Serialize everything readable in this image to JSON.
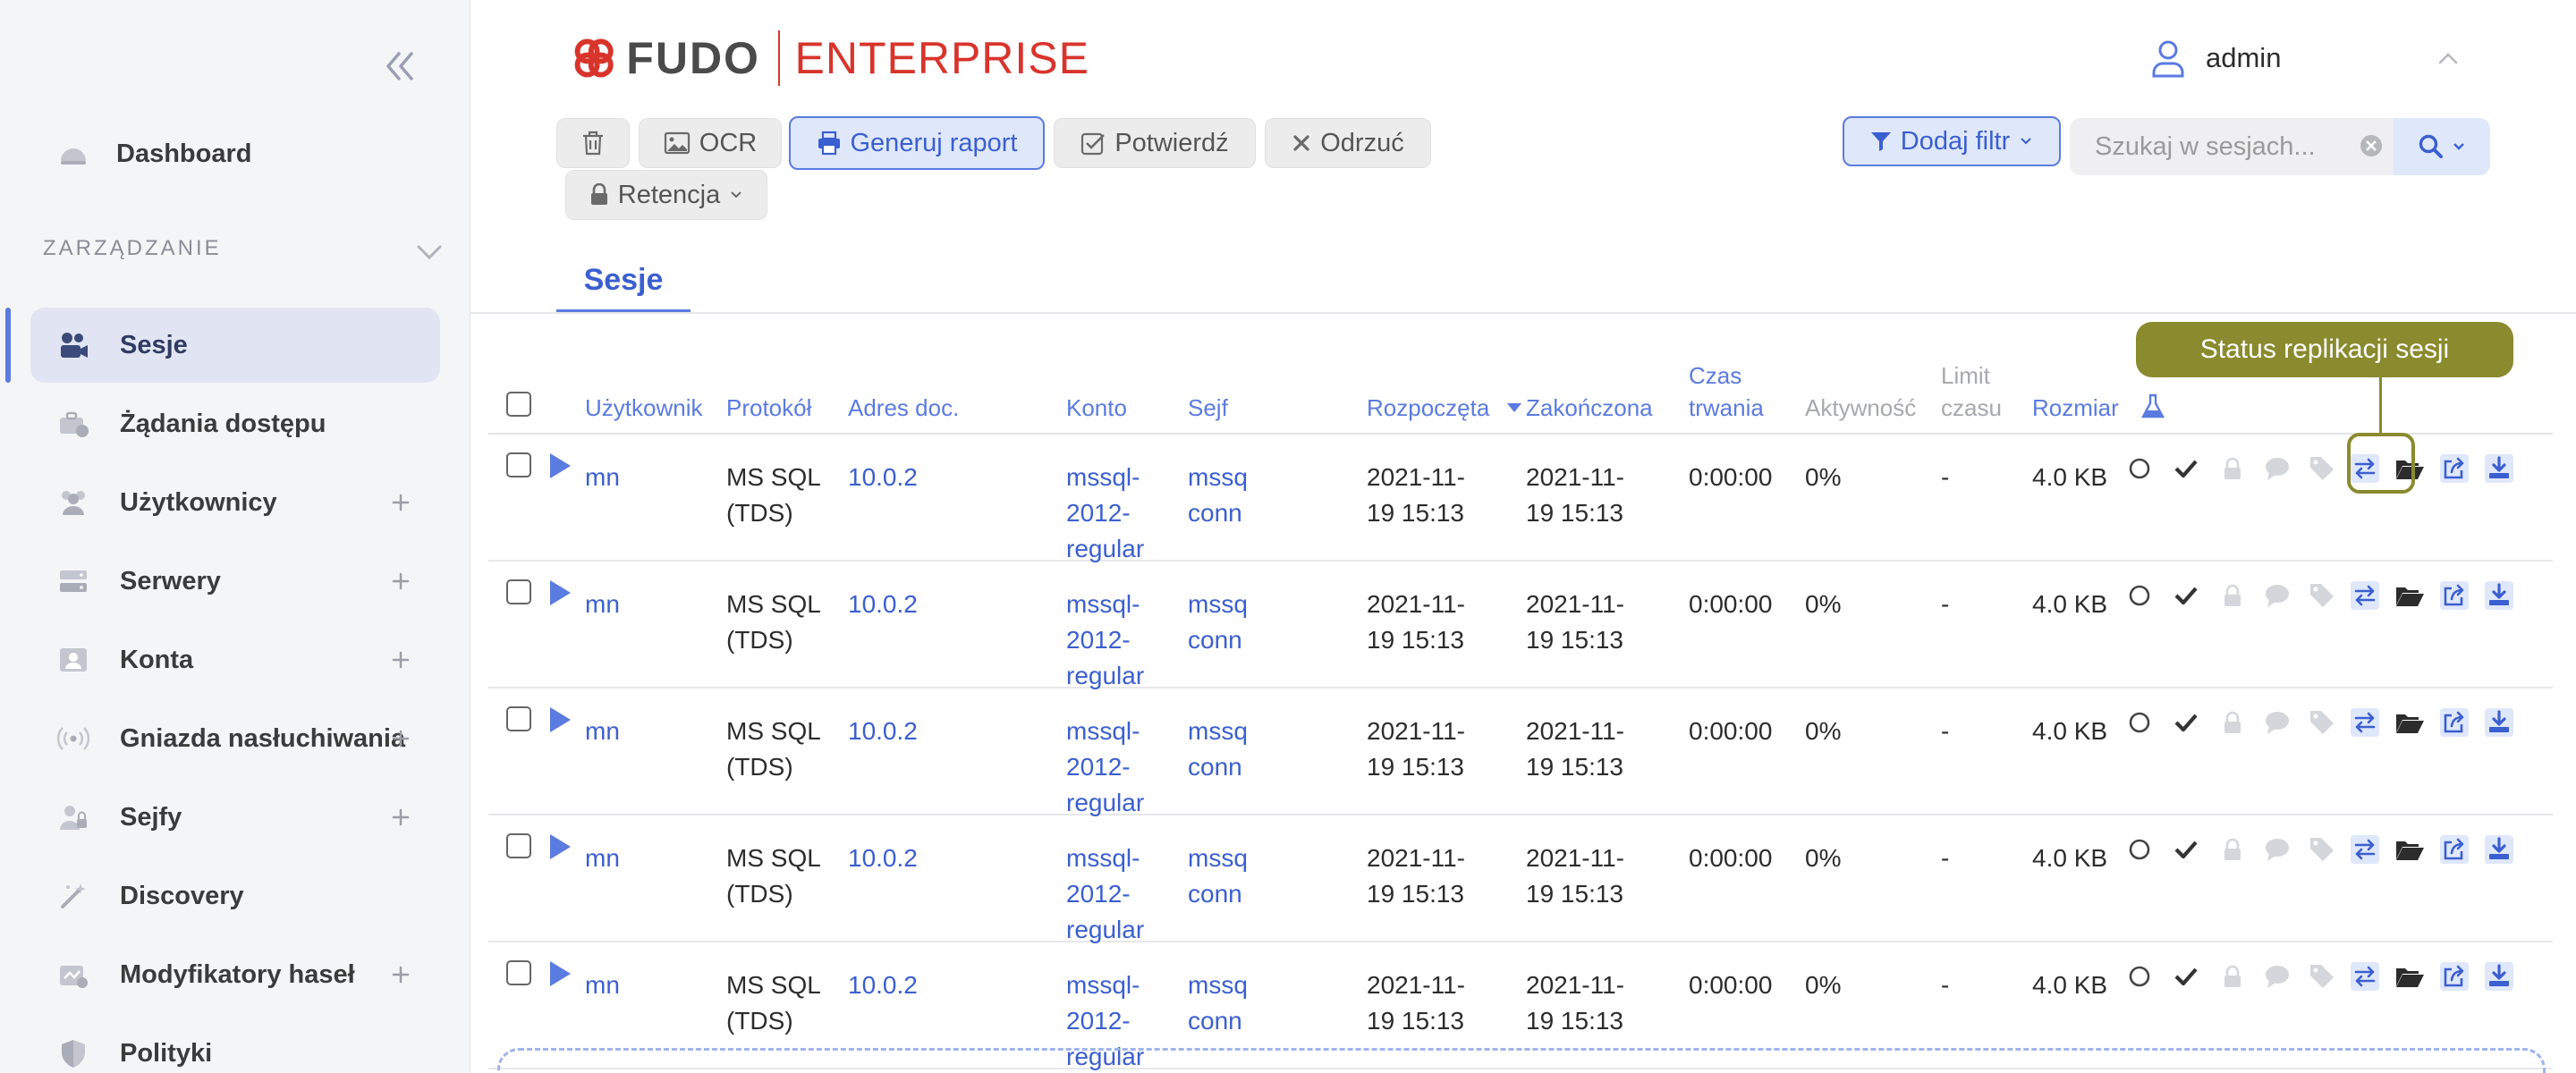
{
  "sidebar": {
    "section_label": "ZARZĄDZANIE",
    "items": [
      {
        "label": "Dashboard",
        "icon": "dashboard-icon",
        "expandable": false,
        "active": false
      },
      {
        "label": "Sesje",
        "icon": "sessions-icon",
        "expandable": false,
        "active": true
      },
      {
        "label": "Żądania dostępu",
        "icon": "briefcase-icon",
        "expandable": false,
        "active": false
      },
      {
        "label": "Użytkownicy",
        "icon": "users-icon",
        "expandable": true,
        "active": false
      },
      {
        "label": "Serwery",
        "icon": "server-icon",
        "expandable": true,
        "active": false
      },
      {
        "label": "Konta",
        "icon": "account-icon",
        "expandable": true,
        "active": false
      },
      {
        "label": "Gniazda nasłuchiwania",
        "icon": "listener-icon",
        "expandable": true,
        "active": false
      },
      {
        "label": "Sejfy",
        "icon": "safe-icon",
        "expandable": true,
        "active": false
      },
      {
        "label": "Discovery",
        "icon": "wand-icon",
        "expandable": false,
        "active": false
      },
      {
        "label": "Modyfikatory haseł",
        "icon": "password-changer-icon",
        "expandable": true,
        "active": false
      },
      {
        "label": "Polityki",
        "icon": "shield-icon",
        "expandable": false,
        "active": false
      }
    ]
  },
  "header": {
    "logo_a": "FUDO",
    "logo_b": "ENTERPRISE",
    "user": "admin"
  },
  "toolbar": {
    "delete_icon": "trash-icon",
    "ocr": "OCR",
    "report": "Generuj raport",
    "confirm": "Potwierdź",
    "reject": "Odrzuć",
    "retention": "Retencja",
    "add_filter": "Dodaj filtr",
    "search_placeholder": "Szukaj w sesjach..."
  },
  "tabs": [
    {
      "label": "Sesje",
      "active": true
    }
  ],
  "table": {
    "columns": {
      "user": "Użytkownik",
      "protocol": "Protokół",
      "address": "Adres doc.",
      "account": "Konto",
      "safe": "Sejf",
      "started": "Rozpoczęta",
      "ended": "Zakończona",
      "duration_1": "Czas",
      "duration_2": "trwania",
      "activity": "Aktywność",
      "limit_1": "Limit",
      "limit_2": "czasu",
      "size": "Rozmiar"
    },
    "sort": {
      "column": "ended",
      "direction": "desc"
    },
    "rows": [
      {
        "user": "mn",
        "protocol_1": "MS SQL",
        "protocol_2": "(TDS)",
        "address": "10.0.2",
        "account_1": "mssql-",
        "account_2": "2012-",
        "account_3": "regular",
        "safe_1": "mssq",
        "safe_2": "conn",
        "started_1": "2021-11-",
        "started_2": "19 15:13",
        "ended_1": "2021-11-",
        "ended_2": "19 15:13",
        "duration": "0:00:00",
        "activity": "0%",
        "limit": "-",
        "size": "4.0 KB"
      },
      {
        "user": "mn",
        "protocol_1": "MS SQL",
        "protocol_2": "(TDS)",
        "address": "10.0.2",
        "account_1": "mssql-",
        "account_2": "2012-",
        "account_3": "regular",
        "safe_1": "mssq",
        "safe_2": "conn",
        "started_1": "2021-11-",
        "started_2": "19 15:13",
        "ended_1": "2021-11-",
        "ended_2": "19 15:13",
        "duration": "0:00:00",
        "activity": "0%",
        "limit": "-",
        "size": "4.0 KB"
      },
      {
        "user": "mn",
        "protocol_1": "MS SQL",
        "protocol_2": "(TDS)",
        "address": "10.0.2",
        "account_1": "mssql-",
        "account_2": "2012-",
        "account_3": "regular",
        "safe_1": "mssq",
        "safe_2": "conn",
        "started_1": "2021-11-",
        "started_2": "19 15:13",
        "ended_1": "2021-11-",
        "ended_2": "19 15:13",
        "duration": "0:00:00",
        "activity": "0%",
        "limit": "-",
        "size": "4.0 KB"
      },
      {
        "user": "mn",
        "protocol_1": "MS SQL",
        "protocol_2": "(TDS)",
        "address": "10.0.2",
        "account_1": "mssql-",
        "account_2": "2012-",
        "account_3": "regular",
        "safe_1": "mssq",
        "safe_2": "conn",
        "started_1": "2021-11-",
        "started_2": "19 15:13",
        "ended_1": "2021-11-",
        "ended_2": "19 15:13",
        "duration": "0:00:00",
        "activity": "0%",
        "limit": "-",
        "size": "4.0 KB"
      },
      {
        "user": "mn",
        "protocol_1": "MS SQL",
        "protocol_2": "(TDS)",
        "address": "10.0.2",
        "account_1": "mssql-",
        "account_2": "2012-",
        "account_3": "regular",
        "safe_1": "mssq",
        "safe_2": "conn",
        "started_1": "2021-11-",
        "started_2": "19 15:13",
        "ended_1": "2021-11-",
        "ended_2": "19 15:13",
        "duration": "0:00:00",
        "activity": "0%",
        "limit": "-",
        "size": "4.0 KB"
      }
    ],
    "row_actions": [
      "status-circle-icon",
      "check-icon",
      "lock-icon",
      "comment-icon",
      "tag-icon",
      "replication-icon",
      "folder-open-icon",
      "share-icon",
      "download-icon"
    ]
  },
  "tooltip": {
    "text": "Status replikacji sesji"
  },
  "colors": {
    "accent": "#5a7be0",
    "brand_red": "#d8342b",
    "tooltip": "#8a8a2e",
    "active_bg": "#e1e5f3"
  }
}
